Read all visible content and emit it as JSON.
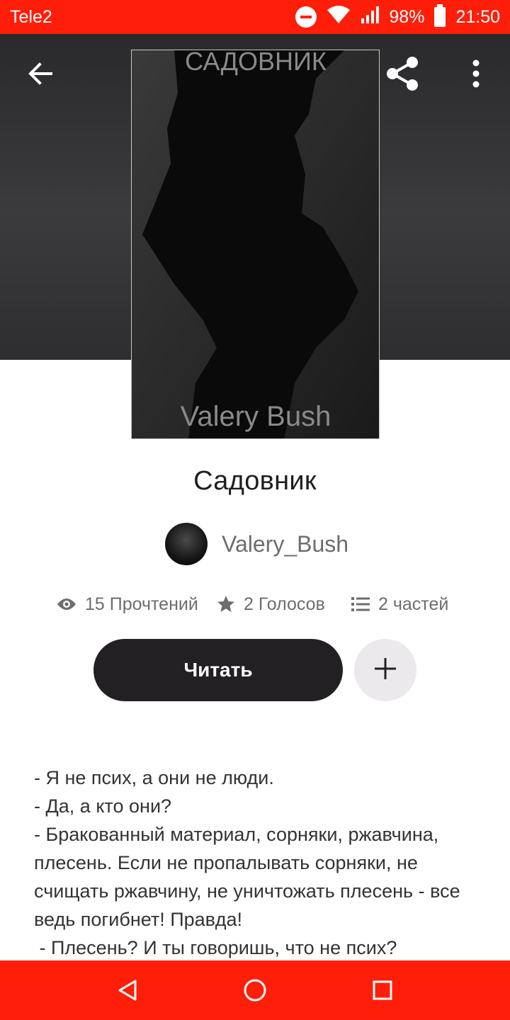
{
  "status_bar": {
    "carrier": "Tele2",
    "battery": "98%",
    "time": "21:50"
  },
  "book": {
    "cover_title": "САДОВНИК",
    "cover_author": "Valery Bush",
    "title": "Садовник",
    "author": "Valery_Bush"
  },
  "stats": {
    "reads": "15 Прочтений",
    "votes": "2 Голосов",
    "parts": "2 частей"
  },
  "actions": {
    "read_label": "Читать"
  },
  "description": "- Я не псих, а они не люди.\n- Да, а кто они?\n- Бракованный материал, сорняки, ржавчина, плесень. Если не пропалывать сорняки, не счищать ржавчину, не уничтожать плесень - все ведь погибнет! Правда!\n - Плесень? И ты говоришь, что не псих?",
  "colors": {
    "accent": "#ff1e0a",
    "button_dark": "#222022"
  }
}
